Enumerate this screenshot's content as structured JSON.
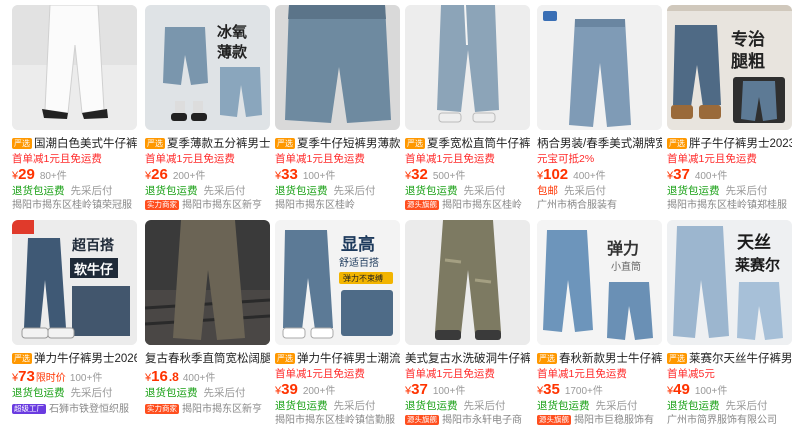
{
  "products": [
    {
      "tag": "严选",
      "title": "国潮白色美式牛仔裤男",
      "promo": "首单减1元且免运费",
      "currency": "¥",
      "price": "29",
      "price_note": "",
      "sold": "80+件",
      "service1": "退货包运费",
      "service2": "先采后付",
      "store_badge": "",
      "store": "揭阳市揭东区桂岭镇荣冠服",
      "svc1_color": "#19a015"
    },
    {
      "tag": "严选",
      "title": "夏季薄款五分裤男士牛",
      "promo": "首单减1元且免运费",
      "currency": "¥",
      "price": "26",
      "price_note": "",
      "sold": "200+件",
      "service1": "退货包运费",
      "service2": "先采后付",
      "store_badge": "实力商家",
      "store": "揭阳市揭东区新亨",
      "svc1_color": "#19a015"
    },
    {
      "tag": "严选",
      "title": "夏季牛仔短裤男薄款中",
      "promo": "首单减1元且免运费",
      "currency": "¥",
      "price": "33",
      "price_note": "",
      "sold": "100+件",
      "service1": "退货包运费",
      "service2": "先采后付",
      "store_badge": "",
      "store": "揭阳市揭东区桂岭",
      "svc1_color": "#19a015"
    },
    {
      "tag": "严选",
      "title": "夏季宽松直筒牛仔裤男",
      "promo": "首单减1元且免运费",
      "currency": "¥",
      "price": "32",
      "price_note": "",
      "sold": "500+件",
      "service1": "退货包运费",
      "service2": "先采后付",
      "store_badge": "源头旗舰",
      "store": "揭阳市揭东区桂岭",
      "svc1_color": "#19a015"
    },
    {
      "tag": "",
      "title": "柄合男装/春季美式潮牌宽",
      "promo": "元宝可抵2%",
      "currency": "¥",
      "price": "102",
      "price_note": "",
      "sold": "400+件",
      "service1": "包邮",
      "service2": "先采后付",
      "store_badge": "",
      "store": "广州市柄合服装有",
      "svc1_color": "#ff3300"
    },
    {
      "tag": "严选",
      "title": "胖子牛仔裤男士2023年",
      "promo": "首单减1元且免运费",
      "currency": "¥",
      "price": "37",
      "price_note": "",
      "sold": "400+件",
      "service1": "退货包运费",
      "service2": "先采后付",
      "store_badge": "",
      "store": "揭阳市揭东区桂岭镇郑桂服",
      "svc1_color": "#19a015"
    },
    {
      "tag": "严选",
      "title": "弹力牛仔裤男士2026年",
      "promo": "",
      "currency": "¥",
      "price": "73",
      "price_note": "限时价",
      "sold": "100+件",
      "service1": "退货包运费",
      "service2": "先采后付",
      "store_badge": "超级工厂",
      "store": "石狮市铁登恒织服",
      "svc1_color": "#19a015"
    },
    {
      "tag": "",
      "title": "复古春秋季直筒宽松阔腿纯",
      "promo": "",
      "currency": "¥",
      "price": "16",
      "price_note": ".8",
      "sold": "400+件",
      "service1": "退货包运费",
      "service2": "先采后付",
      "store_badge": "实力商家",
      "store": "揭阳市揭东区新亨",
      "svc1_color": "#19a015"
    },
    {
      "tag": "严选",
      "title": "弹力牛仔裤男士潮流韩",
      "promo": "首单减1元且免运费",
      "currency": "¥",
      "price": "39",
      "price_note": "",
      "sold": "200+件",
      "service1": "退货包运费",
      "service2": "先采后付",
      "store_badge": "",
      "store": "揭阳市揭东区桂岭镇信勤服",
      "svc1_color": "#19a015"
    },
    {
      "tag": "",
      "title": "美式复古水洗破洞牛仔裤男",
      "promo": "首单减1元且免运费",
      "currency": "¥",
      "price": "37",
      "price_note": "",
      "sold": "100+件",
      "service1": "退货包运费",
      "service2": "先采后付",
      "store_badge": "源头旗舰",
      "store": "揭阳市永轩电子商",
      "svc1_color": "#19a015"
    },
    {
      "tag": "严选",
      "title": "春秋新款男士牛仔裤弹",
      "promo": "首单减1元且免运费",
      "currency": "¥",
      "price": "35",
      "price_note": "",
      "sold": "1700+件",
      "service1": "退货包运费",
      "service2": "先采后付",
      "store_badge": "源头旗舰",
      "store": "揭阳市巨稳服饰有",
      "svc1_color": "#19a015"
    },
    {
      "tag": "严选",
      "title": "莱赛尔天丝牛仔裤男款",
      "promo": "首单减5元",
      "currency": "¥",
      "price": "49",
      "price_note": "",
      "sold": "100+件",
      "service1": "退货包运费",
      "service2": "先采后付",
      "store_badge": "",
      "store": "广州市简界服饰有限公司",
      "svc1_color": "#19a015"
    }
  ]
}
